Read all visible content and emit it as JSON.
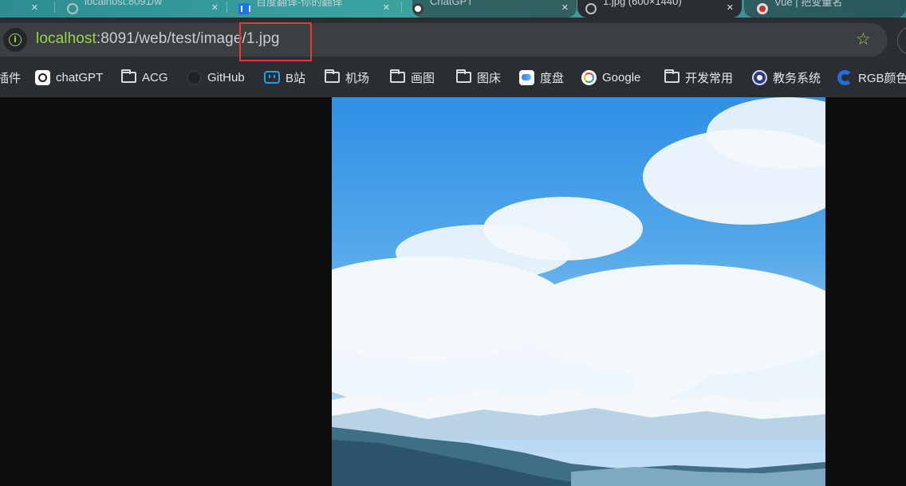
{
  "tabs": [
    {
      "title": "localhost:8091/w",
      "favicon": "globe-icon",
      "active": false
    },
    {
      "title": "百度翻译-你的翻译",
      "favicon": "blue-app-icon",
      "active": false
    },
    {
      "title": "ChatGPT",
      "favicon": "openai-icon",
      "active": false
    },
    {
      "title": "1.jpg (600×1440)",
      "favicon": "globe-icon",
      "active": true
    },
    {
      "title": "Vue | 把变量名",
      "favicon": "red-circle-icon",
      "active": false
    }
  ],
  "address_bar": {
    "host": "localhost",
    "path": ":8091/web/test/image/1.jpg",
    "accent": "#9bd24a"
  },
  "bookmarks": [
    {
      "label": "插件",
      "icon": "folder-icon"
    },
    {
      "label": "chatGPT",
      "icon": "openai-icon"
    },
    {
      "label": "ACG",
      "icon": "folder-icon"
    },
    {
      "label": "GitHub",
      "icon": "github-icon"
    },
    {
      "label": "B站",
      "icon": "bilibili-icon"
    },
    {
      "label": "机场",
      "icon": "folder-icon"
    },
    {
      "label": "画图",
      "icon": "folder-icon"
    },
    {
      "label": "图床",
      "icon": "folder-icon"
    },
    {
      "label": "度盘",
      "icon": "baidu-pan-icon"
    },
    {
      "label": "Google",
      "icon": "google-icon"
    },
    {
      "label": "开发常用",
      "icon": "folder-icon"
    },
    {
      "label": "教务系统",
      "icon": "edu-icon"
    },
    {
      "label": "RGB颜色",
      "icon": "rgb-icon"
    }
  ],
  "colors": {
    "highlight_box": "#e53935",
    "toolbar_bg": "#2a2e33",
    "viewport_bg": "#0e0e0e"
  }
}
